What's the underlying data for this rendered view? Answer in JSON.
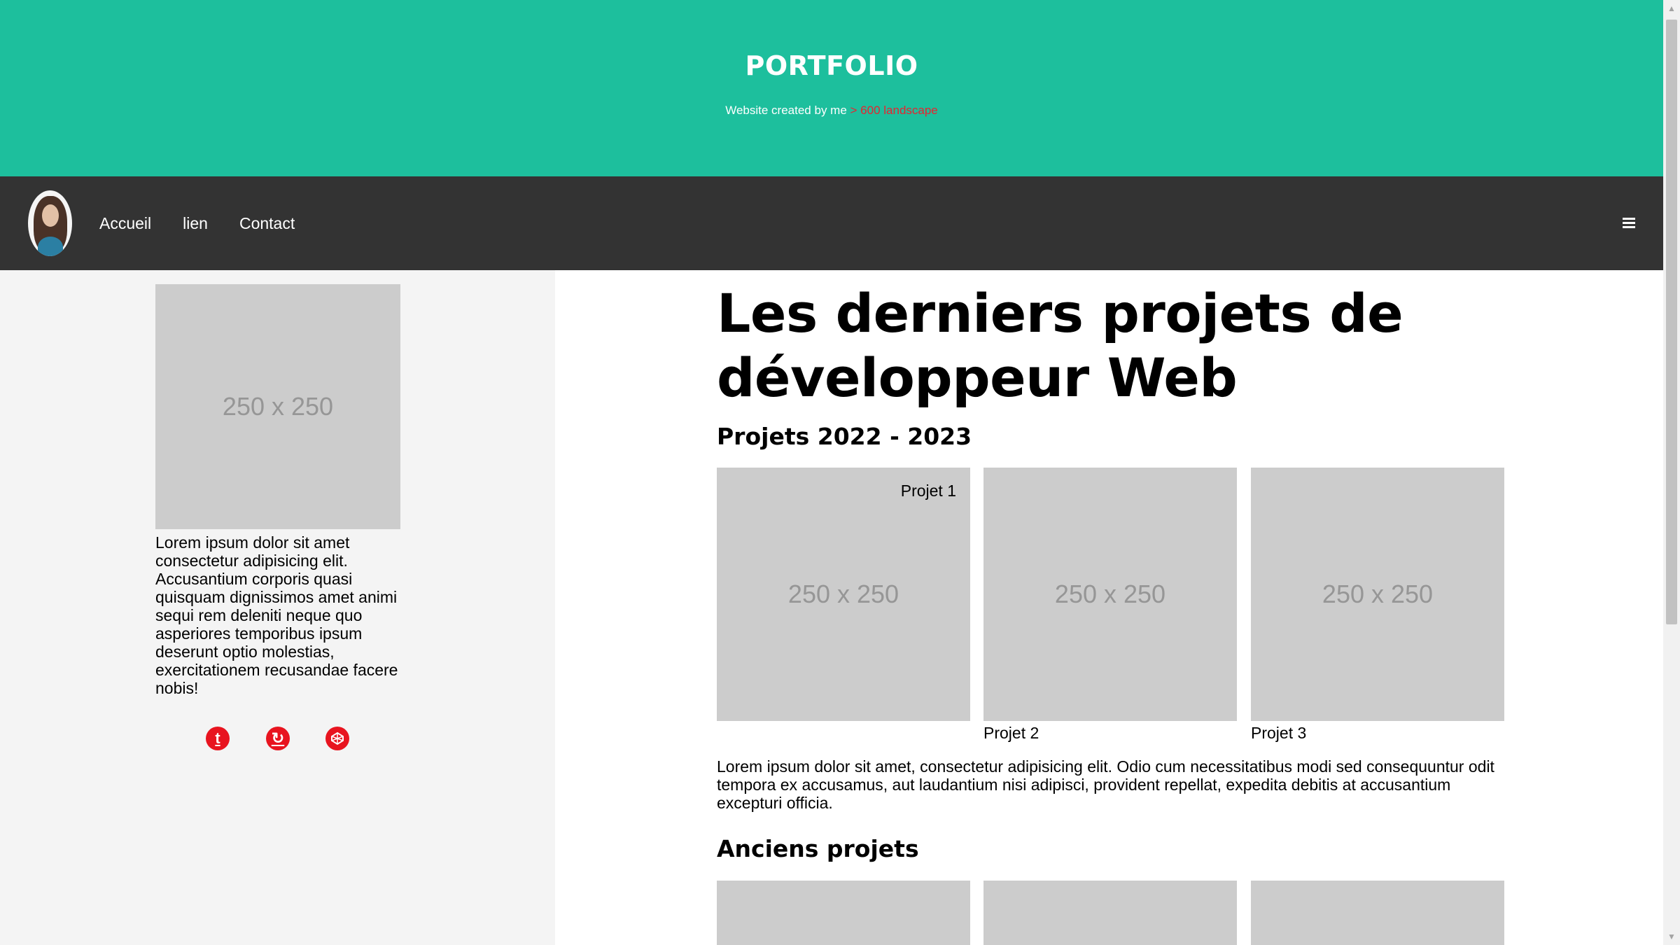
{
  "header": {
    "title": "PORTFOLIO",
    "subtitle": "Website created by me",
    "breakpoint_label": "> 600 landscape",
    "background_color": "#1dbf9d",
    "breakpoint_color": "#e8232f"
  },
  "nav": {
    "avatar_icon": "avatar-icon",
    "links": [
      "Accueil",
      "lien",
      "Contact"
    ],
    "menu_icon": "hamburger-menu-icon",
    "background_color": "#333333"
  },
  "sidebar": {
    "image_label": "250 x 250",
    "text": "Lorem ipsum dolor sit amet consectetur adipisicing elit. Accusantium corporis quasi quisquam dignissimos amet animi sequi rem deleniti neque quo asperiores temporibus ipsum deserunt optio molestias, exercitationem recusandae facere nobis!",
    "social_icons": [
      "tumblr-icon",
      "refresh-icon",
      "codepen-icon"
    ],
    "icon_color": "#e8141f"
  },
  "main": {
    "title": "Les derniers projets de développeur Web",
    "section_recent": "Projets 2022 - 2023",
    "projects": [
      {
        "image_label": "250 x 250",
        "label": "Projet 1"
      },
      {
        "image_label": "250 x 250",
        "label": "Projet 2"
      },
      {
        "image_label": "250 x 250",
        "label": "Projet 3"
      }
    ],
    "description": "Lorem ipsum dolor sit amet, consectetur adipisicing elit. Odio cum necessitatibus modi sed consequuntur odit tempora ex accusamus, aut laudantium nisi adipisci, provident repellat, expedita debitis at accusantium excepturi officia.",
    "section_old": "Anciens projets"
  }
}
